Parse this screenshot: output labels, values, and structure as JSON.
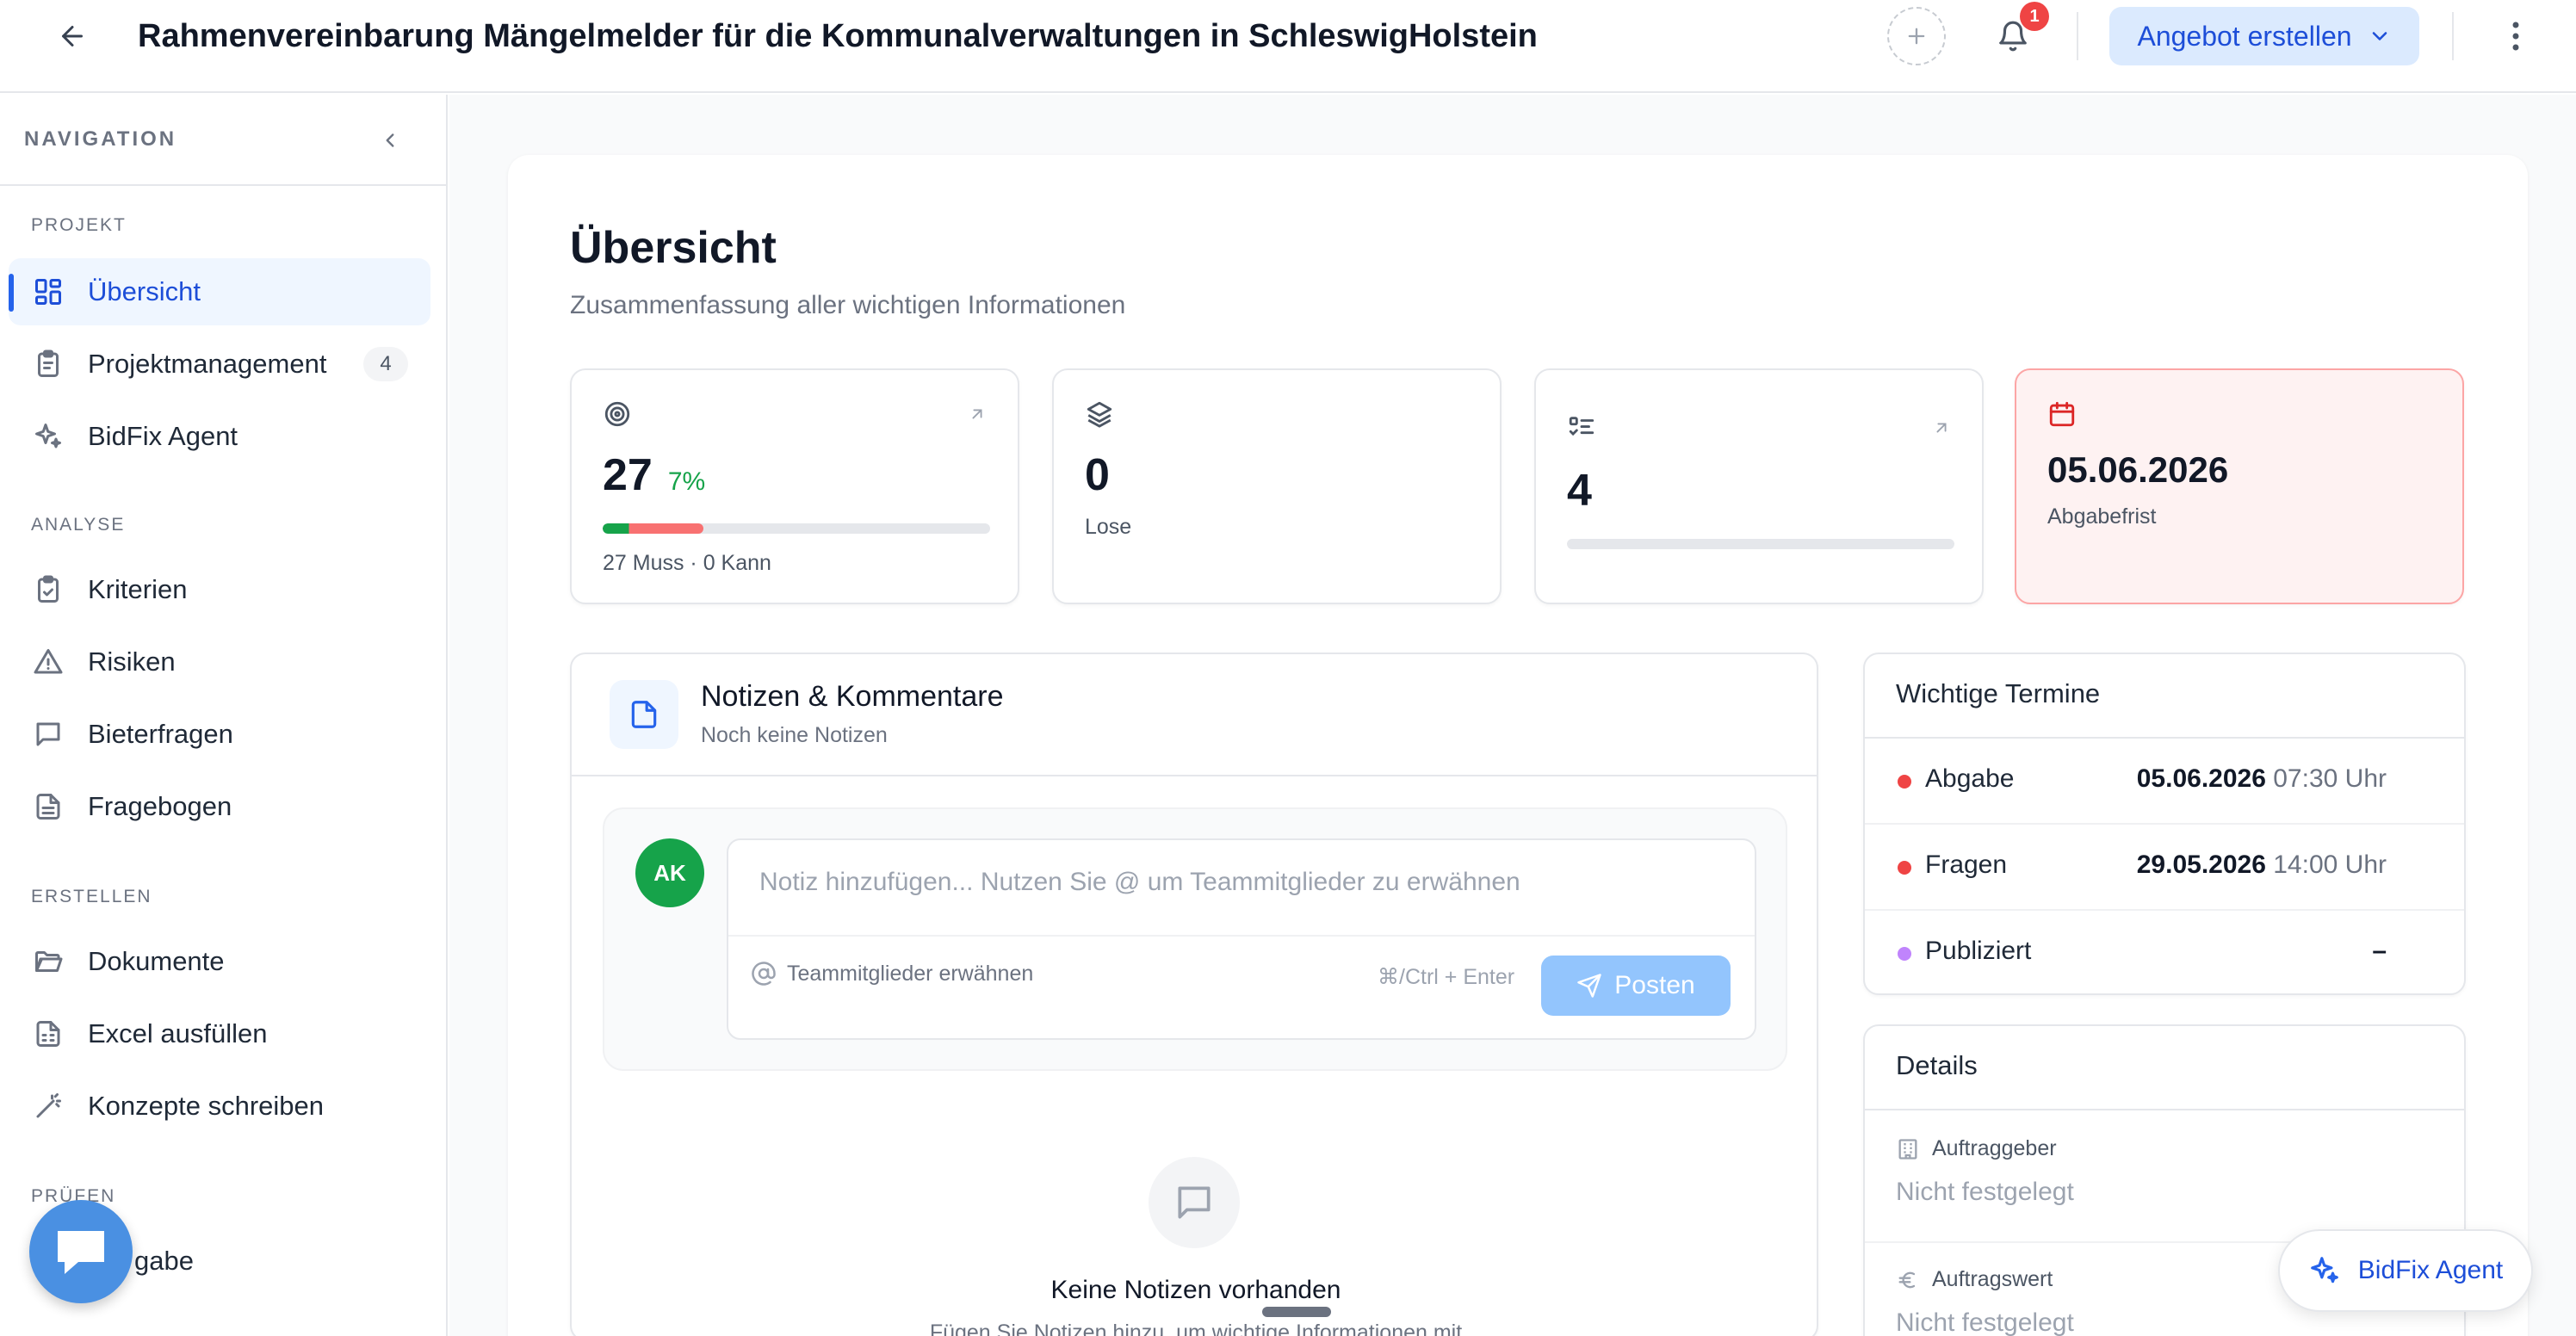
{
  "header": {
    "title": "Rahmenvereinbarung Mängelmelder für die Kommunalverwaltungen in SchleswigHolstein",
    "notification_count": "1",
    "offer_button": "Angebot erstellen"
  },
  "sidebar": {
    "heading": "NAVIGATION",
    "sections": {
      "projekt": "PROJEKT",
      "analyse": "ANALYSE",
      "erstellen": "ERSTELLEN",
      "pruefen": "PRÜFEN"
    },
    "items": {
      "uebersicht": "Übersicht",
      "projektmanagement": "Projektmanagement",
      "projektmanagement_count": "4",
      "bidfix_agent": "BidFix Agent",
      "kriterien": "Kriterien",
      "risiken": "Risiken",
      "bieterfragen": "Bieterfragen",
      "fragebogen": "Fragebogen",
      "dokumente": "Dokumente",
      "excel": "Excel ausfüllen",
      "konzepte": "Konzepte schreiben",
      "abgabe_partial": "gabe"
    }
  },
  "main": {
    "title": "Übersicht",
    "subtitle": "Zusammenfassung aller wichtigen Informationen",
    "stats": {
      "criteria_value": "27",
      "criteria_percent": "7%",
      "criteria_progress": 0.26,
      "criteria_caption": "27 Muss · 0 Kann",
      "lots_value": "0",
      "lots_caption": "Lose",
      "questions_value": "4",
      "deadline_value": "05.06.2026",
      "deadline_caption": "Abgabefrist"
    },
    "notes": {
      "title": "Notizen & Kommentare",
      "subtitle": "Noch keine Notizen",
      "avatar": "AK",
      "placeholder": "Notiz hinzufügen... Nutzen Sie @ um Teammitglieder zu erwähnen",
      "mention_hint": "Teammitglieder erwähnen",
      "shortcut": "⌘/Ctrl + Enter",
      "post_button": "Posten",
      "empty_title": "Keine Notizen vorhanden",
      "empty_text": "Fügen Sie Notizen hinzu, um wichtige Informationen mit"
    },
    "dates": {
      "title": "Wichtige Termine",
      "rows": [
        {
          "label": "Abgabe",
          "date": "05.06.2026",
          "time": "07:30 Uhr",
          "color": "#ef4444"
        },
        {
          "label": "Fragen",
          "date": "29.05.2026",
          "time": "14:00 Uhr",
          "color": "#ef4444"
        },
        {
          "label": "Publiziert",
          "date": "–",
          "time": "",
          "color": "#c084fc"
        }
      ]
    },
    "details": {
      "title": "Details",
      "client_label": "Auftraggeber",
      "client_value": "Nicht festgelegt",
      "value_label": "Auftragswert",
      "value_value": "Nicht festgelegt"
    }
  },
  "agent_fab": "BidFix Agent",
  "colors": {
    "accent": "#2563eb",
    "accent_light": "#dbeafe",
    "success": "#22c55e",
    "danger": "#ef4444",
    "avatar": "#16a34a"
  }
}
